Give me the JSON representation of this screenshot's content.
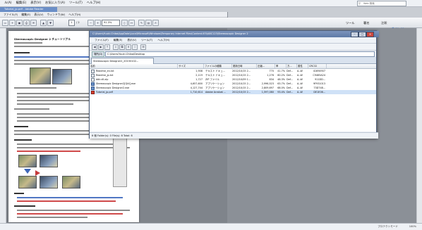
{
  "browser": {
    "menu": [
      "ル(A)",
      "編集(E)",
      "表示(V)",
      "お気に入り(A)",
      "ツール(T)",
      "ヘルプ(H)"
    ],
    "search_placeholder": "Web 検索",
    "tab_label": "Tutorial_jp.pdf - Adobe Reader"
  },
  "pdf": {
    "menu": [
      "ファイル(F)",
      "編集(E)",
      "表示(V)",
      "ウィンドウ(W)",
      "ヘルプ(H)"
    ],
    "page_number": "1",
    "page_total": "/ 2",
    "zoom": "91.3%",
    "tools_label": "ツール",
    "sign_label": "署名",
    "comment_label": "注釈",
    "signin_label": "サインイン",
    "status_text": "プロテクトモード",
    "status_zoom": "100%"
  },
  "doc": {
    "heading": "Stereoscopic Designer 2 チュートリアル"
  },
  "explorer": {
    "title": "C:\\Users\\Yuuki.Chiba\\AppData\\Local\\Microsoft\\Windows\\Temporary Internet Files\\Content.IE5\\ABC123\\Stereoscopic Designer 2",
    "menu": [
      "ファイル(F)",
      "編集(E)",
      "表示(V)",
      "ツール(T)",
      "ヘルプ(H)"
    ],
    "address_label": "場所(D)",
    "address_value": "C:\\Users\\Yuuki.Chiba\\Desktop",
    "tab_label": "Stereoscopic Designer2_20150102...",
    "columns": [
      "名前",
      "サイズ",
      "ファイルの種類",
      "更新日時",
      "圧縮...",
      "率",
      "方...",
      "属性",
      "CRC32"
    ],
    "files": [
      {
        "name": "Readme_en.txt",
        "size": "1,908",
        "type": "テキスト ドキュ...",
        "date": "2012/10/15 2...",
        "packed": "770",
        "ratio": "41.7%",
        "method": "Def...",
        "attr": "A--W",
        "crc": "41694907",
        "icon": "txt"
      },
      {
        "name": "Readme_jp.txt",
        "size": "2,119",
        "type": "テキスト ドキュ...",
        "date": "2012/10/15 2...",
        "packed": "1,276",
        "ratio": "60.2%",
        "method": "Def...",
        "attr": "A--W",
        "crc": "C9465A24",
        "icon": "txt"
      },
      {
        "name": "ddir.dll.zip",
        "size": "1,727",
        "type": "ZIP ファイル",
        "date": "2012/10/09 1...",
        "packed": "834",
        "ratio": "48.3%",
        "method": "Def...",
        "attr": "A--W",
        "crc": "911DD...",
        "icon": "txt"
      },
      {
        "name": "Stereoscopic Designer2[Qt4].exe",
        "size": "4,657,600",
        "type": "アプリケーション",
        "date": "2012/10/15 2...",
        "packed": "2,996,523",
        "ratio": "63.7%",
        "method": "Def...",
        "attr": "A--W",
        "crc": "9F931013",
        "icon": "exe"
      },
      {
        "name": "Stereoscopic Designer2.exe",
        "size": "4,127,744",
        "type": "アプリケーション",
        "date": "2012/10/15 2...",
        "packed": "2,809,697",
        "ratio": "68.0%",
        "method": "Def...",
        "attr": "A--W",
        "crc": "73D748...",
        "icon": "exe"
      },
      {
        "name": "Tutorial_jp.pdf",
        "size": "1,710,614",
        "type": "Adobe Acrobat ...",
        "date": "2012/10/15 2...",
        "packed": "1,597,080",
        "ratio": "93.4%",
        "method": "Def...",
        "attr": "A--W",
        "crc": "DE1E06...",
        "icon": "pdf"
      }
    ],
    "status": "6 個  Folder(s): 0  File(s): 6  Total: 6"
  }
}
